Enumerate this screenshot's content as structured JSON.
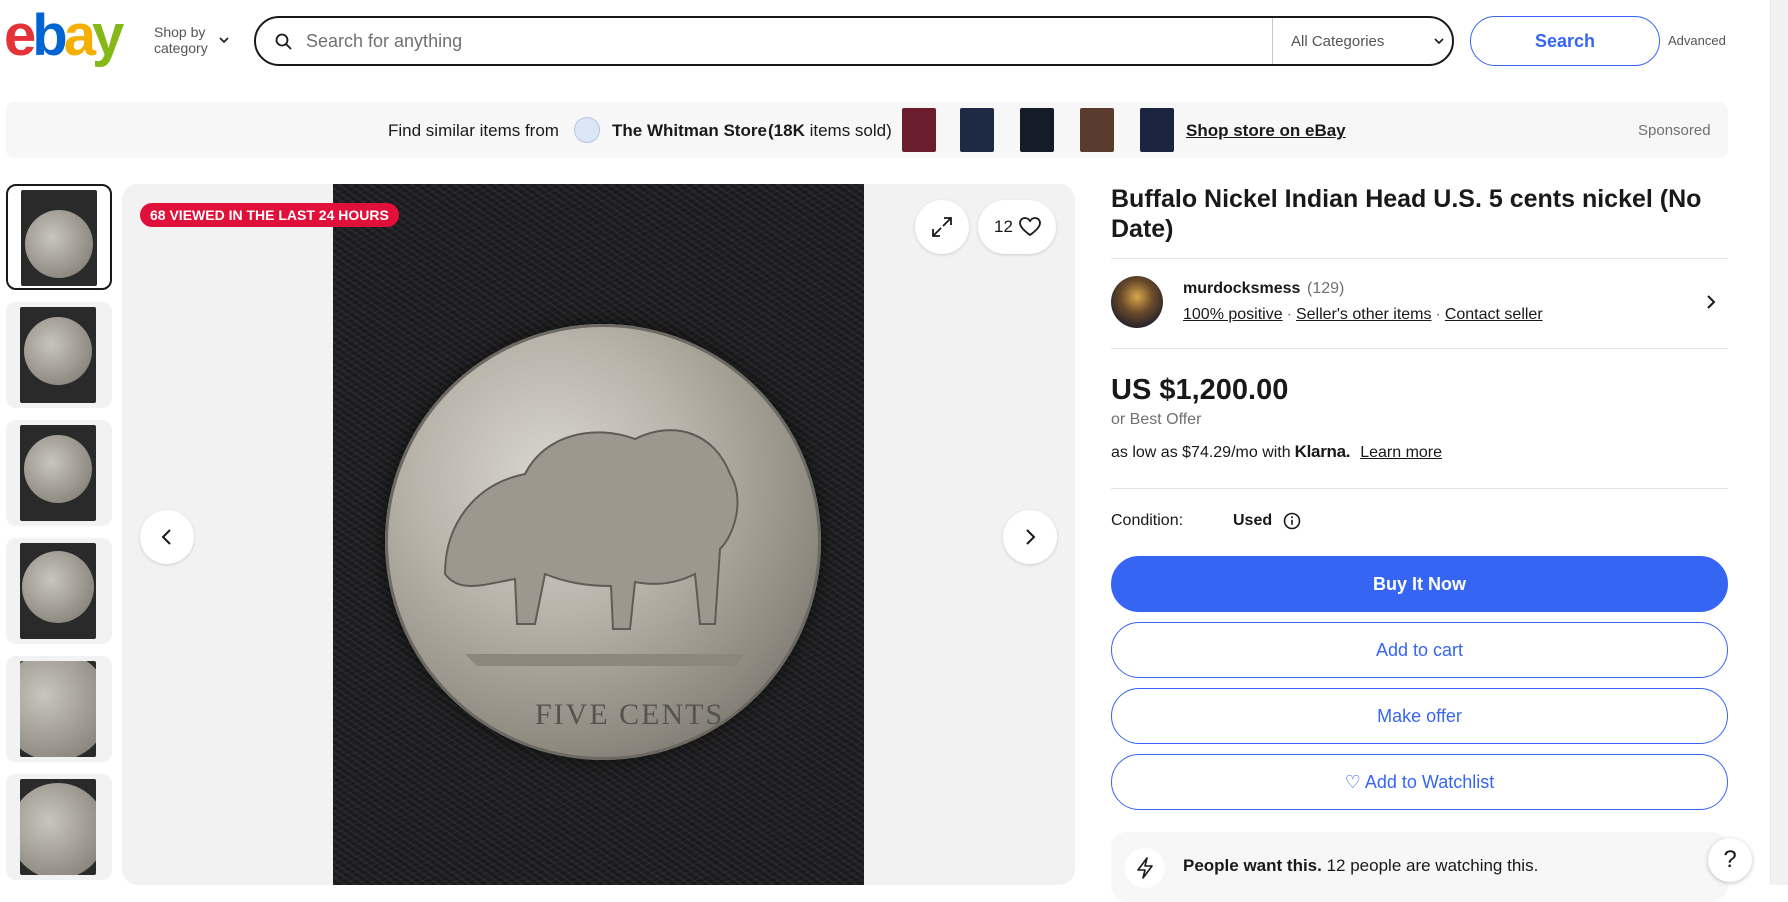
{
  "header": {
    "logo": [
      "e",
      "b",
      "a",
      "y"
    ],
    "logo_colors": [
      "#e53238",
      "#0064d2",
      "#f5af02",
      "#86b817"
    ],
    "shop_by": "Shop by category",
    "search_placeholder": "Search for anything",
    "category": "All Categories",
    "search_button": "Search",
    "advanced": "Advanced"
  },
  "sponsor_bar": {
    "find_similar": "Find similar items from",
    "store_name": "The Whitman Store",
    "items_sold_count": "(18K",
    "items_sold_text": "items sold)",
    "shop_store": "Shop store on eBay",
    "sponsored": "Sponsored",
    "thumb_colors": [
      "#6b1d2e",
      "#1e2a44",
      "#141c2a",
      "#5a3b2e",
      "#1b2540"
    ]
  },
  "gallery": {
    "viewed_badge": "68 VIEWED IN THE LAST 24 HOURS",
    "watch_count": "12",
    "thumbnail_count": 6
  },
  "listing": {
    "title": "Buffalo Nickel Indian Head U.S. 5 cents nickel (No Date)",
    "seller": {
      "name": "murdocksmess",
      "feedback_count": "(129)",
      "positive": "100% positive",
      "other_items": "Seller's other items",
      "contact": "Contact seller"
    },
    "price": "US $1,200.00",
    "best_offer": "or Best Offer",
    "klarna_prefix": "as low as $74.29/mo with",
    "klarna_brand": "Klarna.",
    "learn_more": "Learn more",
    "condition_label": "Condition:",
    "condition_value": "Used",
    "buttons": {
      "buy_now": "Buy It Now",
      "add_to_cart": "Add to cart",
      "make_offer": "Make offer",
      "watchlist": "♡ Add to Watchlist"
    },
    "people_want_bold": "People want this.",
    "people_want_rest": "12 people are watching this."
  },
  "help": "?"
}
